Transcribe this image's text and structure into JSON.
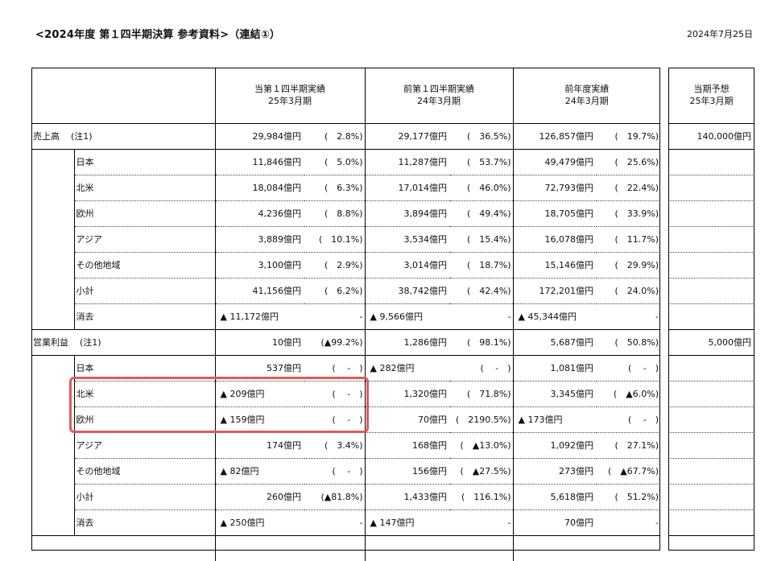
{
  "header": {
    "title": "<2024年度 第１四半期決算 参考資料>（連結①）",
    "date": "2024年7月25日"
  },
  "columns": {
    "current": [
      "当第１四半期実績",
      "25年3月期"
    ],
    "prior": [
      "前第１四半期実績",
      "24年3月期"
    ],
    "last_year": [
      "前年度実績",
      "24年3月期"
    ],
    "forecast": [
      "当期予想",
      "25年3月期"
    ]
  },
  "sections": [
    {
      "label": "売上高",
      "note": "(注1)",
      "total": {
        "cur": "29,984億円",
        "cur_pct": "(　2.8%)",
        "pri": "29,177億円",
        "pri_pct": "(　36.5%)",
        "ly": "126,857億円",
        "ly_pct": "(　19.7%)",
        "fc": "140,000億円"
      },
      "rows": [
        {
          "label": "日本",
          "cur": "11,846億円",
          "cur_pct": "(　5.0%)",
          "pri": "11,287億円",
          "pri_pct": "(　53.7%)",
          "ly": "49,479億円",
          "ly_pct": "(　25.6%)"
        },
        {
          "label": "北米",
          "cur": "18,084億円",
          "cur_pct": "(　6.3%)",
          "pri": "17,014億円",
          "pri_pct": "(　46.0%)",
          "ly": "72,793億円",
          "ly_pct": "(　22.4%)"
        },
        {
          "label": "欧州",
          "cur": "4,236億円",
          "cur_pct": "(　8.8%)",
          "pri": "3,894億円",
          "pri_pct": "(　49.4%)",
          "ly": "18,705億円",
          "ly_pct": "(　33.9%)"
        },
        {
          "label": "アジア",
          "cur": "3,889億円",
          "cur_pct": "(　10.1%)",
          "pri": "3,534億円",
          "pri_pct": "(　15.4%)",
          "ly": "16,078億円",
          "ly_pct": "(　11.7%)"
        },
        {
          "label": "その他地域",
          "cur": "3,100億円",
          "cur_pct": "(　2.9%)",
          "pri": "3,014億円",
          "pri_pct": "(　18.7%)",
          "ly": "15,146億円",
          "ly_pct": "(　29.9%)"
        },
        {
          "label": "小計",
          "cur": "41,156億円",
          "cur_pct": "(　6.2%)",
          "pri": "38,742億円",
          "pri_pct": "(　42.4%)",
          "ly": "172,201億円",
          "ly_pct": "(　24.0%)"
        },
        {
          "label": "消去",
          "cur": "▲ 11,172億円",
          "cur_neg": true,
          "cur_pct": "-",
          "pri": "▲ 9,566億円",
          "pri_neg": true,
          "pri_pct": "-",
          "ly": "▲ 45,344億円",
          "ly_neg": true,
          "ly_pct": "-"
        }
      ]
    },
    {
      "label": "営業利益",
      "note": "(注1)",
      "total": {
        "cur": "10億円",
        "cur_pct": "(▲99.2%)",
        "pri": "1,286億円",
        "pri_pct": "(　98.1%)",
        "ly": "5,687億円",
        "ly_pct": "(　50.8%)",
        "fc": "5,000億円"
      },
      "rows": [
        {
          "label": "日本",
          "cur": "537億円",
          "cur_pct": "(　 -　)",
          "pri": "▲ 282億円",
          "pri_neg": true,
          "pri_pct": "(　 -　)",
          "ly": "1,081億円",
          "ly_pct": "(　 -　)"
        },
        {
          "label": "北米",
          "cur": "▲ 209億円",
          "cur_neg": true,
          "cur_pct": "(　 -　)",
          "pri": "1,320億円",
          "pri_pct": "(　71.8%)",
          "ly": "3,345億円",
          "ly_pct": "(　▲6.0%)"
        },
        {
          "label": "欧州",
          "cur": "▲ 159億円",
          "cur_neg": true,
          "cur_pct": "(　 -　)",
          "pri": "70億円",
          "pri_pct": "(　2190.5%)",
          "ly": "▲ 173億円",
          "ly_neg": true,
          "ly_pct": "(　 -　)"
        },
        {
          "label": "アジア",
          "cur": "174億円",
          "cur_pct": "(　3.4%)",
          "pri": "168億円",
          "pri_pct": "(　▲13.0%)",
          "ly": "1,092億円",
          "ly_pct": "(　27.1%)"
        },
        {
          "label": "その他地域",
          "cur": "▲ 82億円",
          "cur_neg": true,
          "cur_pct": "(　 -　)",
          "pri": "156億円",
          "pri_pct": "(　▲27.5%)",
          "ly": "273億円",
          "ly_pct": "(　▲67.7%)"
        },
        {
          "label": "小計",
          "cur": "260億円",
          "cur_pct": "(▲81.8%)",
          "pri": "1,433億円",
          "pri_pct": "(　116.1%)",
          "ly": "5,618億円",
          "ly_pct": "(　51.2%)"
        },
        {
          "label": "消去",
          "cur": "▲ 250億円",
          "cur_neg": true,
          "cur_pct": "-",
          "pri": "▲ 147億円",
          "pri_neg": true,
          "pri_pct": "-",
          "ly": "70億円",
          "ly_pct": "-"
        }
      ]
    }
  ],
  "highlight_color": "#e05a5a"
}
